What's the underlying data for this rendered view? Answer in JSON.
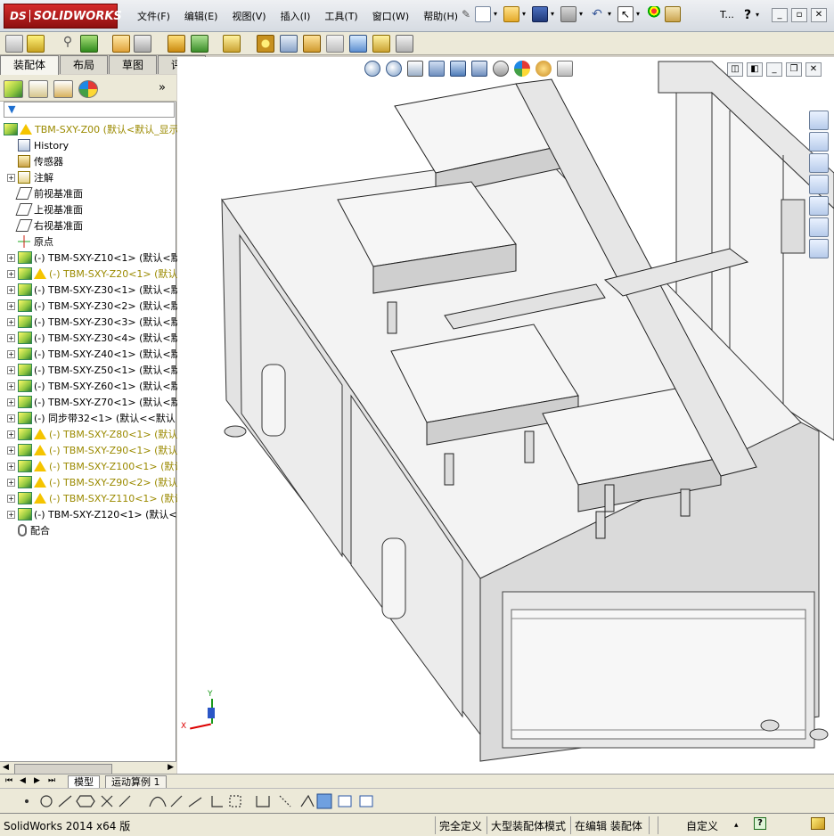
{
  "app": {
    "logo": "SOLIDWORKS",
    "logo_mark": "DS",
    "version_status": "SolidWorks 2014 x64 版"
  },
  "menu": [
    "文件(F)",
    "编辑(E)",
    "视图(V)",
    "插入(I)",
    "工具(T)",
    "窗口(W)",
    "帮助(H)"
  ],
  "header": {
    "search_trunc": "T..."
  },
  "tabs": [
    {
      "label": "装配体",
      "active": true
    },
    {
      "label": "布局",
      "active": false
    },
    {
      "label": "草图",
      "active": false
    },
    {
      "label": "评估",
      "active": false
    }
  ],
  "tree": {
    "root": "TBM-SXY-Z00  (默认<默认_显示",
    "items": [
      {
        "label": "History",
        "kind": "history",
        "exp": false
      },
      {
        "label": "传感器",
        "kind": "sensor",
        "exp": false
      },
      {
        "label": "注解",
        "kind": "annotation",
        "exp": true
      },
      {
        "label": "前视基准面",
        "kind": "plane",
        "exp": false
      },
      {
        "label": "上视基准面",
        "kind": "plane",
        "exp": false
      },
      {
        "label": "右视基准面",
        "kind": "plane",
        "exp": false
      },
      {
        "label": "原点",
        "kind": "origin",
        "exp": false
      },
      {
        "label": "(-) TBM-SXY-Z10<1> (默认<默",
        "kind": "part",
        "warn": false
      },
      {
        "label": "(-) TBM-SXY-Z20<1> (默认<",
        "kind": "part",
        "warn": true
      },
      {
        "label": "(-) TBM-SXY-Z30<1> (默认<默",
        "kind": "part",
        "warn": false
      },
      {
        "label": "(-) TBM-SXY-Z30<2> (默认<默",
        "kind": "part",
        "warn": false
      },
      {
        "label": "(-) TBM-SXY-Z30<3> (默认<默",
        "kind": "part",
        "warn": false
      },
      {
        "label": "(-) TBM-SXY-Z30<4> (默认<默",
        "kind": "part",
        "warn": false
      },
      {
        "label": "(-) TBM-SXY-Z40<1> (默认<默",
        "kind": "part",
        "warn": false
      },
      {
        "label": "(-) TBM-SXY-Z50<1> (默认<默",
        "kind": "part",
        "warn": false
      },
      {
        "label": "(-) TBM-SXY-Z60<1> (默认<默",
        "kind": "part",
        "warn": false
      },
      {
        "label": "(-) TBM-SXY-Z70<1> (默认<默",
        "kind": "part",
        "warn": false
      },
      {
        "label": "(-) 同步带32<1> (默认<<默认",
        "kind": "part2",
        "warn": false
      },
      {
        "label": "(-) TBM-SXY-Z80<1> (默认<",
        "kind": "part",
        "warn": true
      },
      {
        "label": "(-) TBM-SXY-Z90<1> (默认<",
        "kind": "part",
        "warn": true
      },
      {
        "label": "(-) TBM-SXY-Z100<1> (默认<",
        "kind": "part",
        "warn": true
      },
      {
        "label": "(-) TBM-SXY-Z90<2> (默认<",
        "kind": "part",
        "warn": true
      },
      {
        "label": "(-) TBM-SXY-Z110<1> (默认<",
        "kind": "part",
        "warn": true
      },
      {
        "label": "(-) TBM-SXY-Z120<1> (默认<默",
        "kind": "part",
        "warn": false
      },
      {
        "label": "配合",
        "kind": "mates",
        "exp": false
      }
    ]
  },
  "bottom_tabs": [
    "模型",
    "运动算例 1"
  ],
  "status": {
    "fully_defined": "完全定义",
    "large_assembly": "大型装配体模式",
    "editing": "在编辑 装配体",
    "custom": "自定义"
  },
  "triad": {
    "x": "X",
    "y": "Y"
  },
  "colors": {
    "accent": "#c41e1e",
    "warning": "#f5c400",
    "warning_text": "#9b8a00"
  }
}
